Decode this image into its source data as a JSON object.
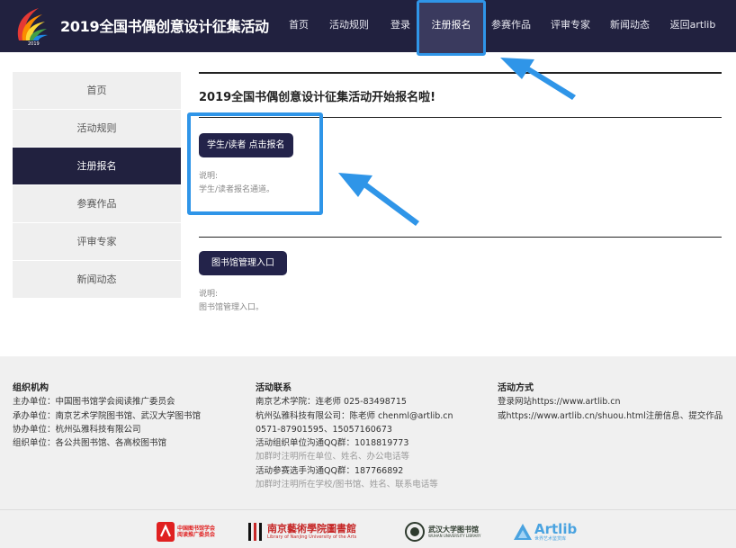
{
  "header": {
    "title": "2019全国书偶创意设计征集活动",
    "logo_year": "2019",
    "nav": [
      {
        "label": "首页"
      },
      {
        "label": "活动规则"
      },
      {
        "label": "登录"
      },
      {
        "label": "注册报名"
      },
      {
        "label": "参赛作品"
      },
      {
        "label": "评审专家"
      },
      {
        "label": "新闻动态"
      },
      {
        "label": "返回artlib"
      }
    ],
    "active_nav": "注册报名"
  },
  "sidebar": {
    "items": [
      {
        "label": "首页"
      },
      {
        "label": "活动规则"
      },
      {
        "label": "注册报名"
      },
      {
        "label": "参赛作品"
      },
      {
        "label": "评审专家"
      },
      {
        "label": "新闻动态"
      }
    ],
    "active_item": "注册报名"
  },
  "main": {
    "title": "2019全国书偶创意设计征集活动开始报名啦!",
    "student_button": "学生/读者 点击报名",
    "student_note_label": "说明:",
    "student_note_text": "学生/读者报名通道。",
    "library_button": "图书馆管理入口",
    "library_note_label": "说明:",
    "library_note_text": "图书馆管理入口。"
  },
  "footer": {
    "org": {
      "title": "组织机构",
      "lines": [
        "主办单位：中国图书馆学会阅读推广委员会",
        "承办单位：南京艺术学院图书馆、武汉大学图书馆",
        "协办单位：杭州弘雅科技有限公司",
        "组织单位：各公共图书馆、各高校图书馆"
      ]
    },
    "contact": {
      "title": "活动联系",
      "lines": [
        "南京艺术学院：连老师 025-83498715",
        "杭州弘雅科技有限公司：陈老师 chenml@artlib.cn",
        "0571-87901595、15057160673",
        "活动组织单位沟通QQ群：1018819773"
      ],
      "muted_1": "加群时注明所在单位、姓名、办公电话等",
      "line_5": "活动参赛选手沟通QQ群：187766892",
      "muted_2": "加群时注明所在学校/图书馆、姓名、联系电话等"
    },
    "method": {
      "title": "活动方式",
      "lines": [
        "登录网站https://www.artlib.cn",
        "或https://www.artlib.cn/shuou.html注册信息、提交作品"
      ]
    },
    "partners": {
      "p1_line1": "中国图书馆学会",
      "p1_line2": "阅读推广委员会",
      "p2_line1": "南京藝術學院圖書館",
      "p2_line2": "Library of Nanjing University of the Arts",
      "p3": "武汉大学图书馆",
      "p3_sub": "WUHAN UNIVERSITY LIBRARY",
      "p4": "Artlib",
      "p4_sub": "世界艺术鉴赏库"
    }
  },
  "colors": {
    "header_bg": "#21213f",
    "accent_blue": "#2f95e8",
    "button_bg": "#23234a",
    "sidebar_bg": "#efefef",
    "footer_bg": "#f0f0f0"
  }
}
